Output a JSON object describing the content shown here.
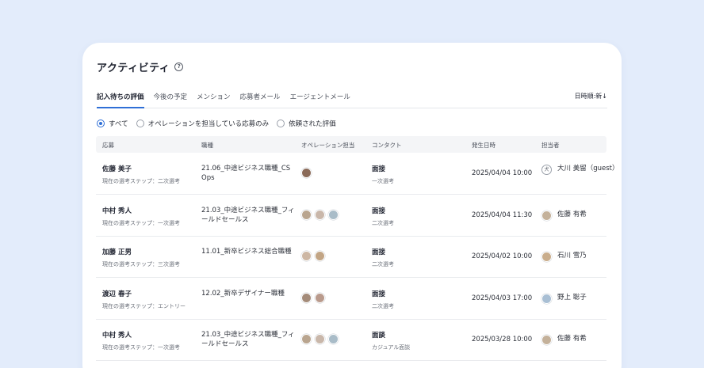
{
  "header": {
    "title": "アクティビティ",
    "help_icon": "?"
  },
  "tabs": [
    {
      "label": "記入待ちの評価",
      "active": true
    },
    {
      "label": "今後の予定",
      "active": false
    },
    {
      "label": "メンション",
      "active": false
    },
    {
      "label": "応募者メール",
      "active": false
    },
    {
      "label": "エージェントメール",
      "active": false
    }
  ],
  "sort_label": "日時順:新↓",
  "filters": [
    {
      "label": "すべて",
      "checked": true
    },
    {
      "label": "オペレーションを担当している応募のみ",
      "checked": false
    },
    {
      "label": "依頼された評価",
      "checked": false
    }
  ],
  "columns": [
    "応募",
    "職種",
    "オペレーション担当",
    "コンタクト",
    "発生日時",
    "担当者"
  ],
  "rows": [
    {
      "name": "佐藤 美子",
      "step": "現在の選考ステップ：二次選考",
      "job": "21.06_中途ビジネス職種_CS Ops",
      "ops_avatars": [
        "#8a6a58"
      ],
      "contact": "面接",
      "contact_sub": "一次選考",
      "date": "2025/04/04 10:00",
      "owner": "大川 美留（guest）",
      "owner_guest": true,
      "owner_avatar": ""
    },
    {
      "name": "中村 秀人",
      "step": "現在の選考ステップ：一次選考",
      "job": "21.03_中途ビジネス職種_フィールドセールス",
      "ops_avatars": [
        "#b9a58f",
        "#c9b7aa",
        "#a9bcc8"
      ],
      "contact": "面接",
      "contact_sub": "二次選考",
      "date": "2025/04/04 11:30",
      "owner": "佐藤 有希",
      "owner_guest": false,
      "owner_avatar": "#c4b19a"
    },
    {
      "name": "加藤 正男",
      "step": "現在の選考ステップ：三次選考",
      "job": "11.01_新卒ビジネス総合職種",
      "ops_avatars": [
        "#cdb7a4",
        "#c2a585"
      ],
      "contact": "面接",
      "contact_sub": "二次選考",
      "date": "2025/04/02 10:00",
      "owner": "石川 雪乃",
      "owner_guest": false,
      "owner_avatar": "#c9ad8c"
    },
    {
      "name": "渡辺 春子",
      "step": "現在の選考ステップ：エントリー",
      "job": "12.02_新卒デザイナー職種",
      "ops_avatars": [
        "#a48b79",
        "#b99a8c"
      ],
      "contact": "面接",
      "contact_sub": "二次選考",
      "date": "2025/04/03 17:00",
      "owner": "野上 聡子",
      "owner_guest": false,
      "owner_avatar": "#a9bfd4"
    },
    {
      "name": "中村 秀人",
      "step": "現在の選考ステップ：一次選考",
      "job": "21.03_中途ビジネス職種_フィールドセールス",
      "ops_avatars": [
        "#b9a58f",
        "#c9b7aa",
        "#a9bcc8"
      ],
      "contact": "面談",
      "contact_sub": "カジュアル面談",
      "date": "2025/03/28 10:00",
      "owner": "佐藤 有希",
      "owner_guest": false,
      "owner_avatar": "#c4b19a"
    }
  ],
  "colors": {
    "accent": "#2f6fd6",
    "page_bg": "#e3ecfb"
  }
}
